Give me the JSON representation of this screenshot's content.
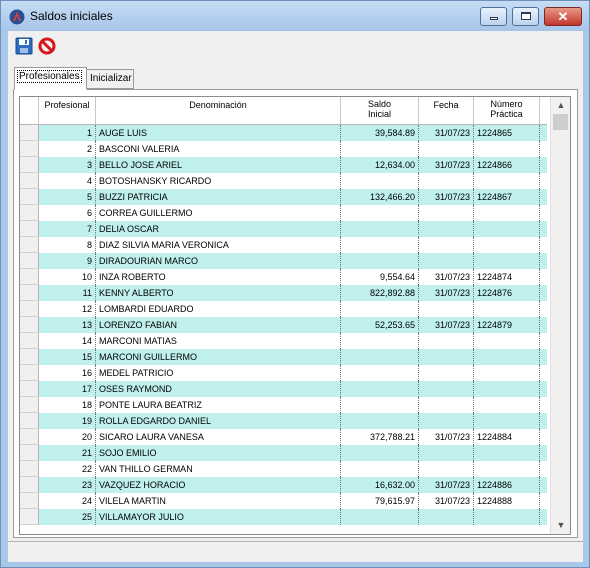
{
  "window": {
    "title": "Saldos iniciales"
  },
  "tabs": [
    {
      "label": "Profesionales",
      "active": true
    },
    {
      "label": "Inicializar",
      "active": false
    }
  ],
  "grid": {
    "columns": [
      "Profesional",
      "Denominación",
      "Saldo\nInicial",
      "Fecha",
      "Número\nPráctica"
    ],
    "rows": [
      {
        "prof": "1",
        "den": "AUGE LUIS",
        "saldo": "39,584.89",
        "fecha": "31/07/23",
        "num": "1224865"
      },
      {
        "prof": "2",
        "den": "BASCONI VALERIA",
        "saldo": "",
        "fecha": "",
        "num": ""
      },
      {
        "prof": "3",
        "den": "BELLO JOSE ARIEL",
        "saldo": "12,634.00",
        "fecha": "31/07/23",
        "num": "1224866"
      },
      {
        "prof": "4",
        "den": "BOTOSHANSKY RICARDO",
        "saldo": "",
        "fecha": "",
        "num": ""
      },
      {
        "prof": "5",
        "den": "BUZZI PATRICIA",
        "saldo": "132,466.20",
        "fecha": "31/07/23",
        "num": "1224867"
      },
      {
        "prof": "6",
        "den": "CORREA GUILLERMO",
        "saldo": "",
        "fecha": "",
        "num": ""
      },
      {
        "prof": "7",
        "den": "DELIA OSCAR",
        "saldo": "",
        "fecha": "",
        "num": ""
      },
      {
        "prof": "8",
        "den": "DIAZ SILVIA MARIA VERONICA",
        "saldo": "",
        "fecha": "",
        "num": ""
      },
      {
        "prof": "9",
        "den": "DIRADOURIAN MARCO",
        "saldo": "",
        "fecha": "",
        "num": ""
      },
      {
        "prof": "10",
        "den": "INZA ROBERTO",
        "saldo": "9,554.64",
        "fecha": "31/07/23",
        "num": "1224874"
      },
      {
        "prof": "11",
        "den": "KENNY ALBERTO",
        "saldo": "822,892.88",
        "fecha": "31/07/23",
        "num": "1224876"
      },
      {
        "prof": "12",
        "den": "LOMBARDI EDUARDO",
        "saldo": "",
        "fecha": "",
        "num": ""
      },
      {
        "prof": "13",
        "den": "LORENZO FABIAN",
        "saldo": "52,253.65",
        "fecha": "31/07/23",
        "num": "1224879"
      },
      {
        "prof": "14",
        "den": "MARCONI MATIAS",
        "saldo": "",
        "fecha": "",
        "num": ""
      },
      {
        "prof": "15",
        "den": "MARCONI GUILLERMO",
        "saldo": "",
        "fecha": "",
        "num": ""
      },
      {
        "prof": "16",
        "den": "MEDEL PATRICIO",
        "saldo": "",
        "fecha": "",
        "num": ""
      },
      {
        "prof": "17",
        "den": "OSES RAYMOND",
        "saldo": "",
        "fecha": "",
        "num": ""
      },
      {
        "prof": "18",
        "den": "PONTE LAURA BEATRIZ",
        "saldo": "",
        "fecha": "",
        "num": ""
      },
      {
        "prof": "19",
        "den": "ROLLA EDGARDO DANIEL",
        "saldo": "",
        "fecha": "",
        "num": ""
      },
      {
        "prof": "20",
        "den": "SICARO LAURA VANESA",
        "saldo": "372,788.21",
        "fecha": "31/07/23",
        "num": "1224884"
      },
      {
        "prof": "21",
        "den": "SOJO EMILIO",
        "saldo": "",
        "fecha": "",
        "num": ""
      },
      {
        "prof": "22",
        "den": "VAN THILLO GERMAN",
        "saldo": "",
        "fecha": "",
        "num": ""
      },
      {
        "prof": "23",
        "den": "VAZQUEZ HORACIO",
        "saldo": "16,632.00",
        "fecha": "31/07/23",
        "num": "1224886"
      },
      {
        "prof": "24",
        "den": "VILELA MARTIN",
        "saldo": "79,615.97",
        "fecha": "31/07/23",
        "num": "1224888"
      },
      {
        "prof": "25",
        "den": "VILLAMAYOR JULIO",
        "saldo": "",
        "fecha": "",
        "num": ""
      }
    ]
  },
  "icons": {
    "app": "app-logo-icon",
    "save": "save-icon",
    "cancel": "cancel-icon",
    "scroll_up": "chevron-up-icon",
    "scroll_down": "chevron-down-icon"
  },
  "colors": {
    "row_alt": "#bff0ee",
    "titlebar": "#a9c8e9",
    "close": "#c2352a"
  }
}
